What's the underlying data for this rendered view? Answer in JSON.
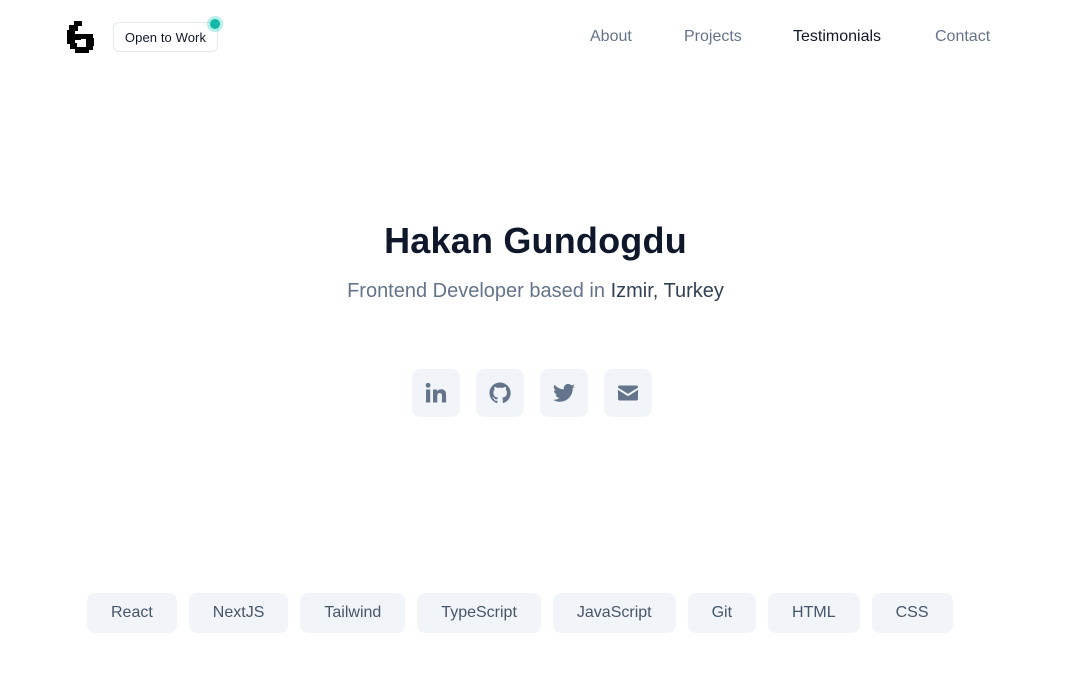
{
  "header": {
    "logo_icon": "stylized-g-logo-icon",
    "status_label": "Open to Work",
    "status_color": "#14b8a6",
    "nav": [
      {
        "label": "About",
        "active": false
      },
      {
        "label": "Projects",
        "active": false
      },
      {
        "label": "Testimonials",
        "active": true
      },
      {
        "label": "Contact",
        "active": false
      }
    ]
  },
  "hero": {
    "name": "Hakan Gundogdu",
    "subtitle_prefix": "Frontend Developer based in ",
    "location": "Izmir, Turkey"
  },
  "socials": [
    {
      "icon": "linkedin-icon"
    },
    {
      "icon": "github-icon"
    },
    {
      "icon": "twitter-icon"
    },
    {
      "icon": "email-icon"
    }
  ],
  "tech_tags": [
    "React",
    "NextJS",
    "Tailwind",
    "TypeScript",
    "JavaScript",
    "Git",
    "HTML",
    "CSS"
  ],
  "colors": {
    "text_dark": "#0f172a",
    "text_muted": "#64748b",
    "chip_bg": "#f1f5f9"
  }
}
